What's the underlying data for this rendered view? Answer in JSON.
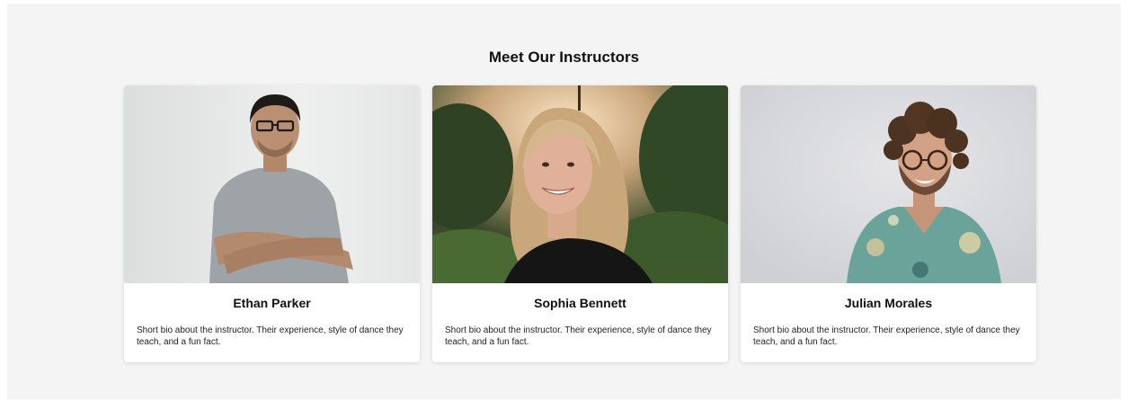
{
  "section": {
    "title": "Meet Our Instructors"
  },
  "instructors": [
    {
      "name": "Ethan Parker",
      "bio": "Short bio about the instructor. Their experience, style of dance they teach, and a fun fact.",
      "photo_icon": "man-arms-crossed-photo"
    },
    {
      "name": "Sophia Bennett",
      "bio": "Short bio about the instructor. Their experience, style of dance they teach, and a fun fact.",
      "photo_icon": "smiling-woman-outdoors-photo"
    },
    {
      "name": "Julian Morales",
      "bio": "Short bio about the instructor. Their experience, style of dance they teach, and a fun fact.",
      "photo_icon": "curly-haired-man-glasses-photo"
    }
  ],
  "colors": {
    "section_bg": "#f4f4f4",
    "card_bg": "#ffffff",
    "text": "#111111"
  }
}
